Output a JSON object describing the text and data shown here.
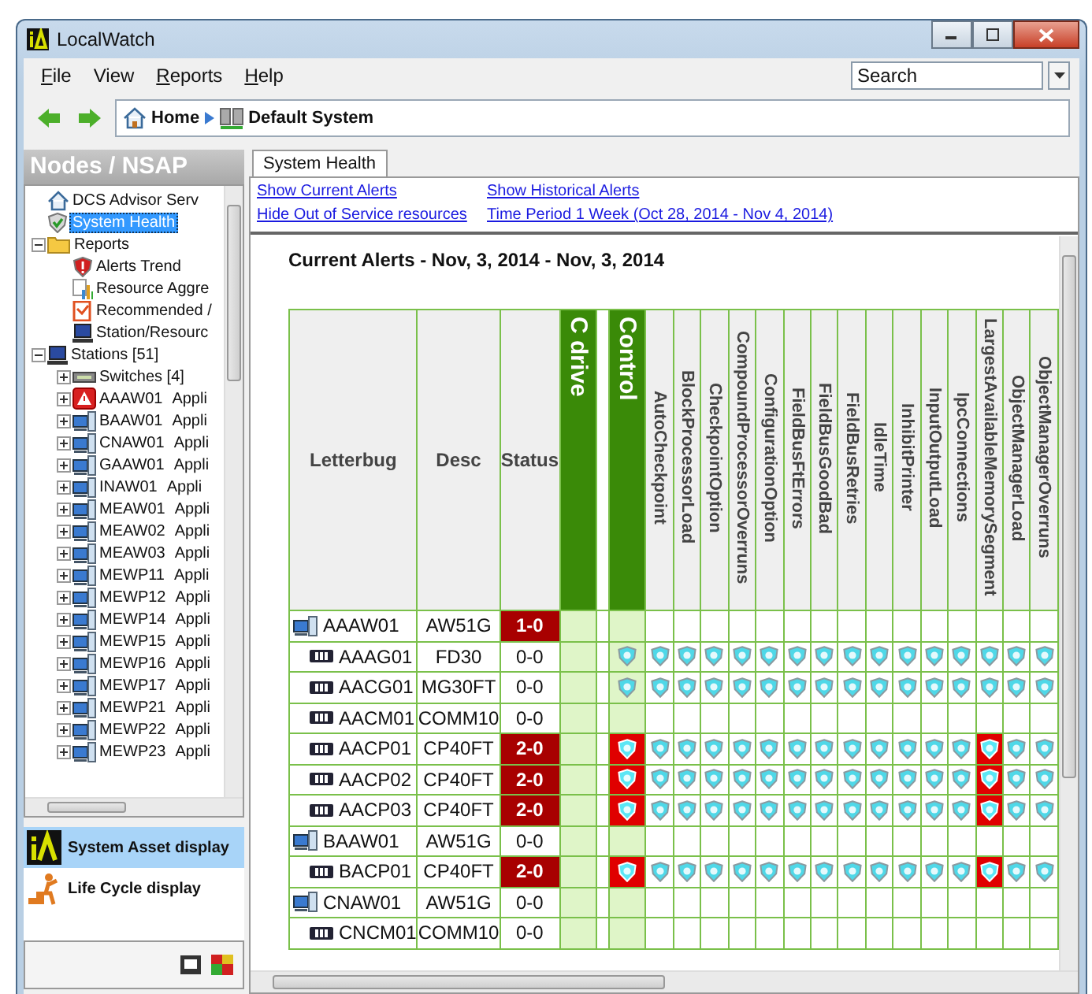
{
  "window": {
    "title": "LocalWatch"
  },
  "menu": [
    {
      "label": "File",
      "underlined": true
    },
    {
      "label": "View",
      "underlined": false
    },
    {
      "label": "Reports",
      "underlined": true
    },
    {
      "label": "Help",
      "underlined": true
    }
  ],
  "search": {
    "placeholder": "Search"
  },
  "breadcrumb": [
    "Home",
    "Default System"
  ],
  "sidebar": {
    "title": "Nodes / NSAP",
    "tree": [
      {
        "label": "DCS Advisor Serv",
        "kind": "server",
        "selected": false
      },
      {
        "label": "System Health",
        "kind": "health",
        "selected": true
      },
      {
        "label": "Reports",
        "kind": "folder",
        "selected": false,
        "expanded": true,
        "children": [
          {
            "label": "Alerts Trend",
            "kind": "alert",
            "selected": false
          },
          {
            "label": "Resource Aggre",
            "kind": "chart",
            "selected": false
          },
          {
            "label": "Recommended /",
            "kind": "report",
            "selected": false
          },
          {
            "label": "Station/Resourc",
            "kind": "station",
            "selected": false
          }
        ]
      },
      {
        "label": "Stations [51]",
        "kind": "station",
        "selected": false,
        "expanded": true,
        "children": [
          {
            "label": "Switches [4]",
            "kind": "switch",
            "selected": false,
            "expanded": false
          },
          {
            "label": "AAAW01",
            "desc": "Appli",
            "kind": "alarm",
            "selected": false,
            "expanded": false
          },
          {
            "label": "BAAW01",
            "desc": "Appli",
            "kind": "workstation",
            "selected": false,
            "expanded": false
          },
          {
            "label": "CNAW01",
            "desc": "Appli",
            "kind": "workstation",
            "selected": false,
            "expanded": false
          },
          {
            "label": "GAAW01",
            "desc": "Appli",
            "kind": "workstation",
            "selected": false,
            "expanded": false
          },
          {
            "label": "INAW01",
            "desc": "Appli",
            "kind": "workstation",
            "selected": false,
            "expanded": false
          },
          {
            "label": "MEAW01",
            "desc": "Appli",
            "kind": "workstation",
            "selected": false,
            "expanded": false
          },
          {
            "label": "MEAW02",
            "desc": "Appli",
            "kind": "workstation",
            "selected": false,
            "expanded": false
          },
          {
            "label": "MEAW03",
            "desc": "Appli",
            "kind": "workstation",
            "selected": false,
            "expanded": false
          },
          {
            "label": "MEWP11",
            "desc": "Appli",
            "kind": "workstation",
            "selected": false,
            "expanded": false
          },
          {
            "label": "MEWP12",
            "desc": "Appli",
            "kind": "workstation",
            "selected": false,
            "expanded": false
          },
          {
            "label": "MEWP14",
            "desc": "Appli",
            "kind": "workstation",
            "selected": false,
            "expanded": false
          },
          {
            "label": "MEWP15",
            "desc": "Appli",
            "kind": "workstation",
            "selected": false,
            "expanded": false
          },
          {
            "label": "MEWP16",
            "desc": "Appli",
            "kind": "workstation",
            "selected": false,
            "expanded": false
          },
          {
            "label": "MEWP17",
            "desc": "Appli",
            "kind": "workstation",
            "selected": false,
            "expanded": false
          },
          {
            "label": "MEWP21",
            "desc": "Appli",
            "kind": "workstation",
            "selected": false,
            "expanded": false
          },
          {
            "label": "MEWP22",
            "desc": "Appli",
            "kind": "workstation",
            "selected": false,
            "expanded": false
          },
          {
            "label": "MEWP23",
            "desc": "Appli",
            "kind": "workstation",
            "selected": false,
            "expanded": false
          }
        ]
      }
    ],
    "displays": [
      {
        "label": "System Asset display",
        "kind": "asset",
        "selected": true
      },
      {
        "label": "Life Cycle display",
        "kind": "lifecycle",
        "selected": false
      }
    ]
  },
  "tabs": [
    {
      "label": "System Health",
      "selected": true
    }
  ],
  "links": [
    "Show Current Alerts",
    "Show Historical Alerts",
    "Hide Out of Service resources",
    "Time Period 1 Week (Oct 28, 2014 - Nov 4, 2014)"
  ],
  "table": {
    "title": "Current Alerts - Nov, 3, 2014 - Nov, 3, 2014",
    "columns": [
      {
        "label": "Letterbug",
        "kind": "plain"
      },
      {
        "label": "Desc",
        "kind": "plain"
      },
      {
        "label": "Status",
        "kind": "plain"
      },
      {
        "label": "C drive",
        "kind": "group"
      },
      {
        "kind": "gap"
      },
      {
        "label": "Control",
        "kind": "group"
      },
      {
        "label": "AutoCheckpoint",
        "kind": "metric"
      },
      {
        "label": "BlockProcessorLoad",
        "kind": "metric"
      },
      {
        "label": "CheckpointOption",
        "kind": "metric"
      },
      {
        "label": "CompoundProcessorOverruns",
        "kind": "metric"
      },
      {
        "label": "ConfigurationOption",
        "kind": "metric"
      },
      {
        "label": "FieldBusFtErrors",
        "kind": "metric"
      },
      {
        "label": "FieldBusGoodBad",
        "kind": "metric"
      },
      {
        "label": "FieldBusRetries",
        "kind": "metric"
      },
      {
        "label": "IdleTime",
        "kind": "metric"
      },
      {
        "label": "InhibitPrinter",
        "kind": "metric"
      },
      {
        "label": "InputOutputLoad",
        "kind": "metric"
      },
      {
        "label": "IpcConnections",
        "kind": "metric"
      },
      {
        "label": "LargestAvailableMemorySegment",
        "kind": "metric"
      },
      {
        "label": "ObjectManagerLoad",
        "kind": "metric"
      },
      {
        "label": "ObjectManagerOverruns",
        "kind": "metric"
      }
    ],
    "rows": [
      {
        "kind": "station",
        "letterbug": "AAAW01",
        "desc": "AW51G",
        "status": "1-0",
        "alert": true
      },
      {
        "kind": "module",
        "letterbug": "AAAG01",
        "desc": "FD30",
        "status": "0-0",
        "alert": false,
        "cells": [
          {
            "kind": "ok"
          },
          {
            "kind": "ok"
          },
          {
            "kind": "ok"
          },
          {
            "kind": "ok"
          },
          {
            "kind": "ok"
          },
          {
            "kind": "ok"
          },
          {
            "kind": "ok"
          },
          {
            "kind": "ok"
          },
          {
            "kind": "ok"
          },
          {
            "kind": "ok"
          },
          {
            "kind": "ok"
          },
          {
            "kind": "ok"
          },
          {
            "kind": "ok"
          },
          {
            "kind": "ok"
          },
          {
            "kind": "ok"
          },
          {
            "kind": "ok"
          }
        ]
      },
      {
        "kind": "module",
        "letterbug": "AACG01",
        "desc": "MG30FT",
        "status": "0-0",
        "alert": false,
        "cells": [
          {
            "kind": "ok"
          },
          {
            "kind": "ok"
          },
          {
            "kind": "ok"
          },
          {
            "kind": "ok"
          },
          {
            "kind": "ok"
          },
          {
            "kind": "ok"
          },
          {
            "kind": "ok"
          },
          {
            "kind": "ok"
          },
          {
            "kind": "ok"
          },
          {
            "kind": "ok"
          },
          {
            "kind": "ok"
          },
          {
            "kind": "ok"
          },
          {
            "kind": "ok"
          },
          {
            "kind": "ok"
          },
          {
            "kind": "ok"
          },
          {
            "kind": "ok"
          }
        ]
      },
      {
        "kind": "module",
        "letterbug": "AACM01",
        "desc": "COMM10",
        "status": "0-0",
        "alert": false
      },
      {
        "kind": "module",
        "letterbug": "AACP01",
        "desc": "CP40FT",
        "status": "2-0",
        "alert": true,
        "cells": [
          {
            "kind": "alert"
          },
          {
            "kind": "ok"
          },
          {
            "kind": "ok"
          },
          {
            "kind": "ok"
          },
          {
            "kind": "ok"
          },
          {
            "kind": "ok"
          },
          {
            "kind": "ok"
          },
          {
            "kind": "ok"
          },
          {
            "kind": "ok"
          },
          {
            "kind": "ok"
          },
          {
            "kind": "ok"
          },
          {
            "kind": "ok"
          },
          {
            "kind": "ok"
          },
          {
            "kind": "alert"
          },
          {
            "kind": "ok"
          },
          {
            "kind": "ok"
          }
        ]
      },
      {
        "kind": "module",
        "letterbug": "AACP02",
        "desc": "CP40FT",
        "status": "2-0",
        "alert": true,
        "cells": [
          {
            "kind": "alert"
          },
          {
            "kind": "ok"
          },
          {
            "kind": "ok"
          },
          {
            "kind": "ok"
          },
          {
            "kind": "ok"
          },
          {
            "kind": "ok"
          },
          {
            "kind": "ok"
          },
          {
            "kind": "ok"
          },
          {
            "kind": "ok"
          },
          {
            "kind": "ok"
          },
          {
            "kind": "ok"
          },
          {
            "kind": "ok"
          },
          {
            "kind": "ok"
          },
          {
            "kind": "alert"
          },
          {
            "kind": "ok"
          },
          {
            "kind": "ok"
          }
        ]
      },
      {
        "kind": "module",
        "letterbug": "AACP03",
        "desc": "CP40FT",
        "status": "2-0",
        "alert": true,
        "cells": [
          {
            "kind": "alert"
          },
          {
            "kind": "ok"
          },
          {
            "kind": "ok"
          },
          {
            "kind": "ok"
          },
          {
            "kind": "ok"
          },
          {
            "kind": "ok"
          },
          {
            "kind": "ok"
          },
          {
            "kind": "ok"
          },
          {
            "kind": "ok"
          },
          {
            "kind": "ok"
          },
          {
            "kind": "ok"
          },
          {
            "kind": "ok"
          },
          {
            "kind": "ok"
          },
          {
            "kind": "alert"
          },
          {
            "kind": "ok"
          },
          {
            "kind": "ok"
          }
        ]
      },
      {
        "kind": "station",
        "letterbug": "BAAW01",
        "desc": "AW51G",
        "status": "0-0",
        "alert": false
      },
      {
        "kind": "module",
        "letterbug": "BACP01",
        "desc": "CP40FT",
        "status": "2-0",
        "alert": true,
        "cells": [
          {
            "kind": "alert"
          },
          {
            "kind": "ok"
          },
          {
            "kind": "ok"
          },
          {
            "kind": "ok"
          },
          {
            "kind": "ok"
          },
          {
            "kind": "ok"
          },
          {
            "kind": "ok"
          },
          {
            "kind": "ok"
          },
          {
            "kind": "ok"
          },
          {
            "kind": "ok"
          },
          {
            "kind": "ok"
          },
          {
            "kind": "ok"
          },
          {
            "kind": "ok"
          },
          {
            "kind": "alert"
          },
          {
            "kind": "ok"
          },
          {
            "kind": "ok"
          }
        ]
      },
      {
        "kind": "station",
        "letterbug": "CNAW01",
        "desc": "AW51G",
        "status": "0-0",
        "alert": false
      },
      {
        "kind": "module",
        "letterbug": "CNCM01",
        "desc": "COMM10",
        "status": "0-0",
        "alert": false
      }
    ]
  }
}
